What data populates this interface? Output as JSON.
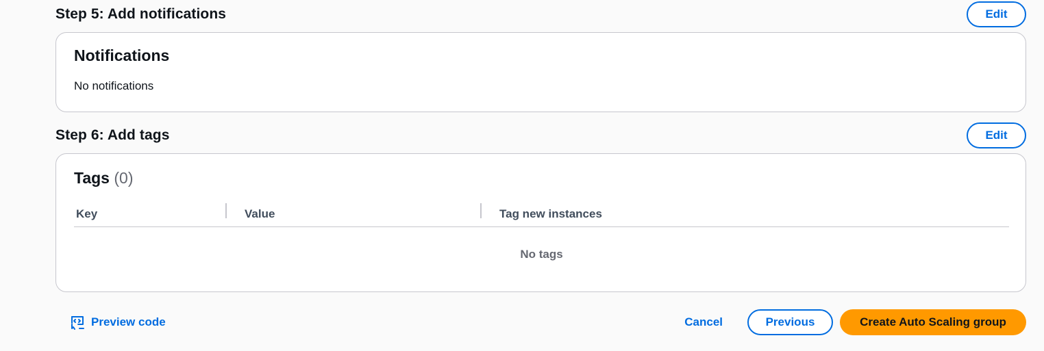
{
  "step5": {
    "title": "Step 5: Add notifications",
    "edit_label": "Edit",
    "card_title": "Notifications",
    "card_text": "No notifications"
  },
  "step6": {
    "title": "Step 6: Add tags",
    "edit_label": "Edit",
    "card_title": "Tags",
    "card_count": "(0)",
    "columns": [
      "Key",
      "Value",
      "Tag new instances"
    ],
    "empty_text": "No tags"
  },
  "footer": {
    "preview_code_label": "Preview code",
    "preview_icon": "preview-code-icon",
    "cancel_label": "Cancel",
    "previous_label": "Previous",
    "create_label": "Create Auto Scaling group"
  },
  "colors": {
    "link_blue": "#006ce0",
    "primary_orange": "#ff9900",
    "border": "#c6c6cd",
    "muted_text": "#656871"
  }
}
